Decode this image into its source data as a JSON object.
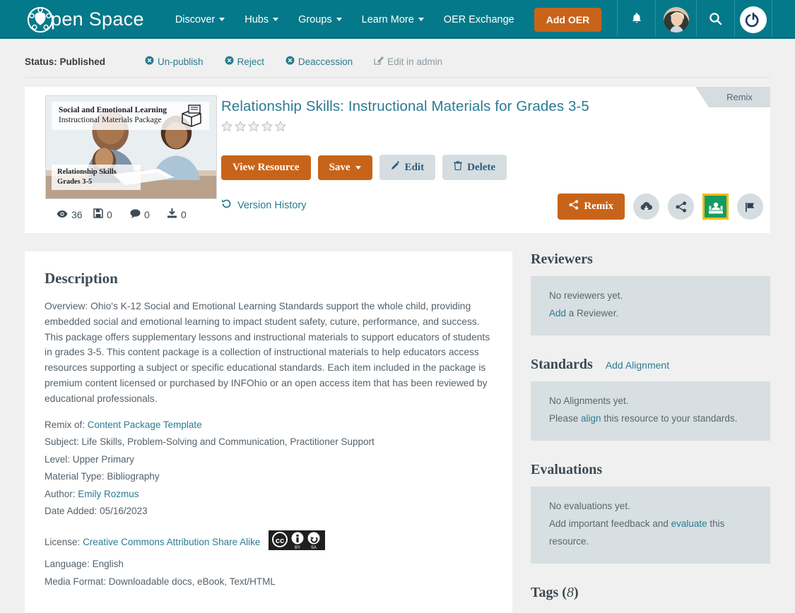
{
  "brand": {
    "name": "pen Space",
    "logo_icon": "open-space-logo-icon"
  },
  "nav": {
    "items": [
      {
        "label": "Discover",
        "has_caret": true
      },
      {
        "label": "Hubs",
        "has_caret": true
      },
      {
        "label": "Groups",
        "has_caret": true
      },
      {
        "label": "Learn More",
        "has_caret": true
      },
      {
        "label": "OER Exchange",
        "has_caret": false
      }
    ],
    "add_oer_label": "Add OER",
    "icons": [
      "bell-icon",
      "avatar",
      "search-icon",
      "power-icon"
    ]
  },
  "status": {
    "label": "Status: Published",
    "actions": [
      {
        "label": "Un-publish",
        "icon": "times-circle-icon"
      },
      {
        "label": "Reject",
        "icon": "times-circle-icon"
      },
      {
        "label": "Deaccession",
        "icon": "times-circle-icon"
      },
      {
        "label": "Edit in admin",
        "icon": "pencil-square-icon"
      }
    ]
  },
  "resource": {
    "ribbon_label": "Remix",
    "title": "Relationship Skills: Instructional Materials for Grades 3-5",
    "rating": 0,
    "stars_total": 5,
    "thumbnail": {
      "line1": "Social and Emotional Learning",
      "line2": "Instructional Materials Package",
      "foot_line1": "Relationship Skills",
      "foot_line2": "Grades 3-5"
    },
    "stats": [
      {
        "icon": "eye-icon",
        "value": "36"
      },
      {
        "icon": "floppy-save-icon",
        "value": "0"
      },
      {
        "icon": "comment-icon",
        "value": "0"
      },
      {
        "icon": "download-icon",
        "value": "0"
      }
    ],
    "buttons": {
      "view_resource": "View Resource",
      "save": "Save",
      "edit": "Edit",
      "delete": "Delete"
    },
    "version_history": "Version History",
    "remix_button": "Remix",
    "action_icons": [
      "cloud-download-icon",
      "share-icon",
      "google-classroom-icon",
      "flag-icon"
    ]
  },
  "description": {
    "heading": "Description",
    "body": "Overview: Ohio's K-12 Social and Emotional Learning Standards support the whole child, providing embedded social and emotional learning to impact student safety, cuture, performance, and success. This package offers supplementary lessons and instructional materials to support educators of students in grades 3-5. This content package is a collection of instructional materials to help educators access resources supporting a subject or specific educational standards. Each item included in the package is premium content licensed or purchased by INFOhio or an open access item that has been reviewed by educational professionals.",
    "meta": {
      "remix_of_label": "Remix of:",
      "remix_of_value": "Content Package Template",
      "subject_label": "Subject:",
      "subject_value": "Life Skills, Problem-Solving and Communication, Practitioner Support",
      "level_label": "Level:",
      "level_value": "Upper Primary",
      "material_type_label": "Material Type:",
      "material_type_value": "Bibliography",
      "author_label": "Author:",
      "author_value": "Emily Rozmus",
      "date_added_label": "Date Added:",
      "date_added_value": "05/16/2023",
      "license_label": "License:",
      "license_value": "Creative Commons Attribution Share Alike",
      "license_badge": "cc-by-sa-badge",
      "language_label": "Language:",
      "language_value": "English",
      "media_format_label": "Media Format:",
      "media_format_value": "Downloadable docs, eBook, Text/HTML"
    }
  },
  "sidebar": {
    "reviewers": {
      "heading": "Reviewers",
      "empty": "No reviewers yet.",
      "add_link": "Add",
      "add_rest": " a Reviewer."
    },
    "standards": {
      "heading": "Standards",
      "add_link": "Add Alignment",
      "empty": "No Alignments yet.",
      "prefix": "Please ",
      "align_link": "align",
      "suffix": " this resource to your standards."
    },
    "evaluations": {
      "heading": "Evaluations",
      "empty": "No evaluations yet.",
      "prefix": "Add important feedback and ",
      "evaluate_link": "evaluate",
      "suffix": " this resource."
    },
    "tags": {
      "heading": "Tags (",
      "count": "8",
      "close": ")"
    }
  },
  "colors": {
    "header_teal": "#04798a",
    "accent_orange": "#c8641a",
    "link_teal": "#2b7c93",
    "panel_gray": "#d7dfe2",
    "page_bg": "#f0f0f0",
    "classroom_green": "#169b62",
    "classroom_border": "#f2c014"
  }
}
